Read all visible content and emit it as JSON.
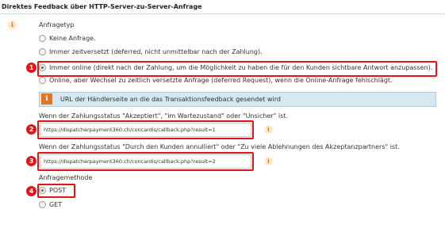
{
  "section": {
    "title": "Direktes Feedback über HTTP-Server-zu-Server-Anfrage"
  },
  "request_type": {
    "label": "Anfragetyp",
    "options": [
      {
        "label": "Keine Anfrage.",
        "checked": false
      },
      {
        "label": "Immer zeitversetzt (deferred, nicht unmittelbar nach der Zahlung).",
        "checked": false
      },
      {
        "label": "Immer online (direkt nach der Zahlung, um die Möglichkeit zu haben die für den Kunden sichtbare Antwort anzupassen).",
        "checked": true
      },
      {
        "label": "Online, aber Wechsel zu zeitlich versetzte Anfrage (deferred Request), wenn die Online-Anfrage fehlschlägt.",
        "checked": false
      }
    ]
  },
  "banner": {
    "icon": "i",
    "text": "URL der Händlerseite an die das Transaktionsfeedback gesendet wird"
  },
  "url_accepted": {
    "label": "Wenn der Zahlungsstatus \"Akzeptiert\", \"im Wartezustand\" oder \"Unsicher\" ist.",
    "value": "https://dispatcherpayment360.ch/concardis/callback.php?result=1"
  },
  "url_cancelled": {
    "label": "Wenn der Zahlungsstatus \"Durch den Kunden annulliert\" oder \"Zu viele Ablehnungen des Akzeptanzpartners\" ist.",
    "value": "https://dispatcherpayment360.ch/concardis/callback.php?result=2"
  },
  "method": {
    "label": "Anfragemethode",
    "options": [
      {
        "label": "POST",
        "checked": true
      },
      {
        "label": "GET",
        "checked": false
      }
    ]
  },
  "badges": [
    "1",
    "2",
    "3",
    "4"
  ],
  "info_glyph": "i",
  "colors": {
    "highlight": "#e3151a",
    "banner_bg": "#d6e8ef",
    "banner_icon": "#e8731f",
    "info_bg": "#fde9c7"
  }
}
